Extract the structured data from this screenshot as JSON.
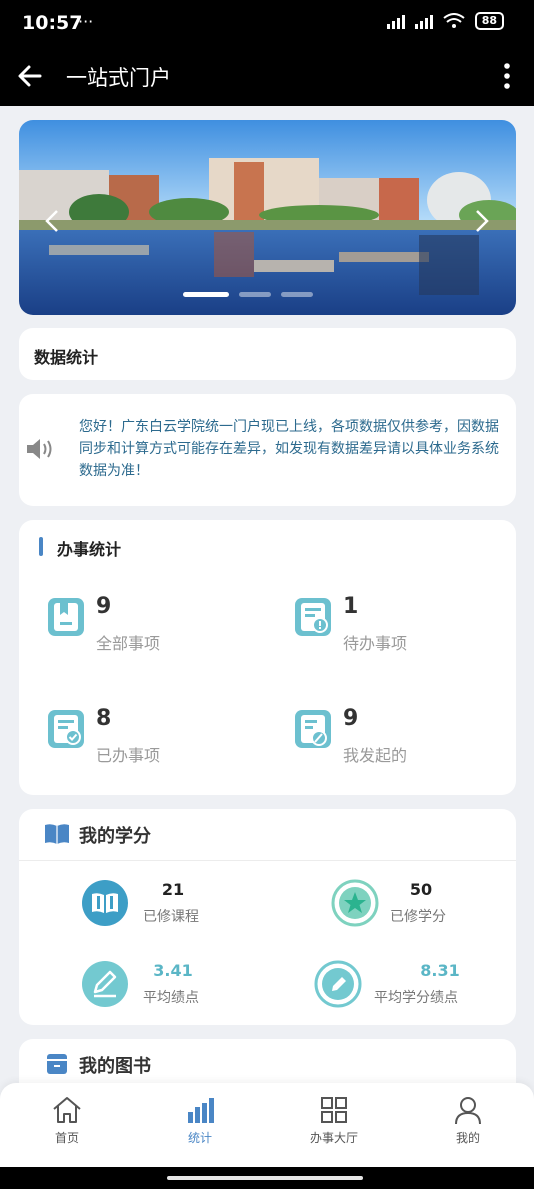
{
  "status": {
    "time": "10:57",
    "extra": "···",
    "battery": "88"
  },
  "app_bar": {
    "title": "一站式门户"
  },
  "stats": {
    "title": "数据统计"
  },
  "notice": {
    "text": "您好！广东白云学院统一门户现已上线，各项数据仅供参考，因数据同步和计算方式可能存在差异，如发现有数据差异请以具体业务系统数据为准！"
  },
  "work": {
    "title": "办事统计",
    "items": [
      {
        "value": "9",
        "label": "全部事项",
        "icon": "bookmark-doc-icon"
      },
      {
        "value": "1",
        "label": "待办事项",
        "icon": "pending-doc-icon"
      },
      {
        "value": "8",
        "label": "已办事项",
        "icon": "done-doc-icon"
      },
      {
        "value": "9",
        "label": "我发起的",
        "icon": "initiated-doc-icon"
      }
    ]
  },
  "credits": {
    "title": "我的学分",
    "items": [
      {
        "value": "21",
        "label": "已修课程",
        "icon": "book-circle-icon"
      },
      {
        "value": "50",
        "label": "已修学分",
        "icon": "star-circle-icon"
      },
      {
        "value": "3.41",
        "label": "平均绩点",
        "icon": "pen-circle-icon"
      },
      {
        "value": "8.31",
        "label": "平均学分绩点",
        "icon": "pencil-circle-icon"
      }
    ]
  },
  "books": {
    "title": "我的图书"
  },
  "tabs": [
    {
      "label": "首页",
      "icon": "home-icon"
    },
    {
      "label": "统计",
      "icon": "bar-chart-icon",
      "active": true
    },
    {
      "label": "办事大厅",
      "icon": "grid-icon"
    },
    {
      "label": "我的",
      "icon": "user-icon"
    }
  ],
  "colors": {
    "accent": "#4a86c5",
    "teal": "#5bb6c6",
    "notice_text": "#2c6a8e"
  }
}
